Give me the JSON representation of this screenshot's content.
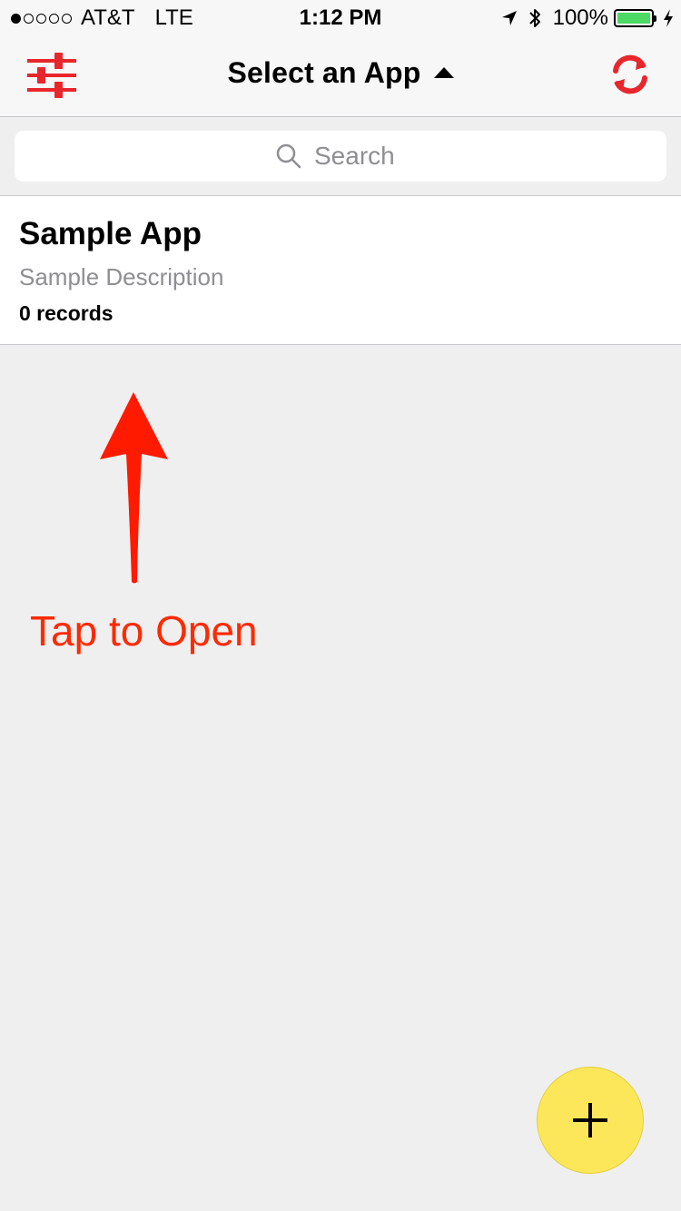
{
  "status_bar": {
    "carrier": "AT&T",
    "network": "LTE",
    "time": "1:12 PM",
    "battery": "100%",
    "battery_color": "#4cd964"
  },
  "nav": {
    "title": "Select an App",
    "left_icon": "sliders-icon",
    "right_icon": "refresh-icon",
    "accent": "#e8262b"
  },
  "search": {
    "placeholder": "Search"
  },
  "apps": [
    {
      "name": "Sample App",
      "description": "Sample Description",
      "records": "0 records"
    }
  ],
  "annotation": {
    "text": "Tap to Open",
    "color": "#ff2a00"
  },
  "fab": {
    "icon": "plus-icon",
    "color": "#fce75a"
  }
}
